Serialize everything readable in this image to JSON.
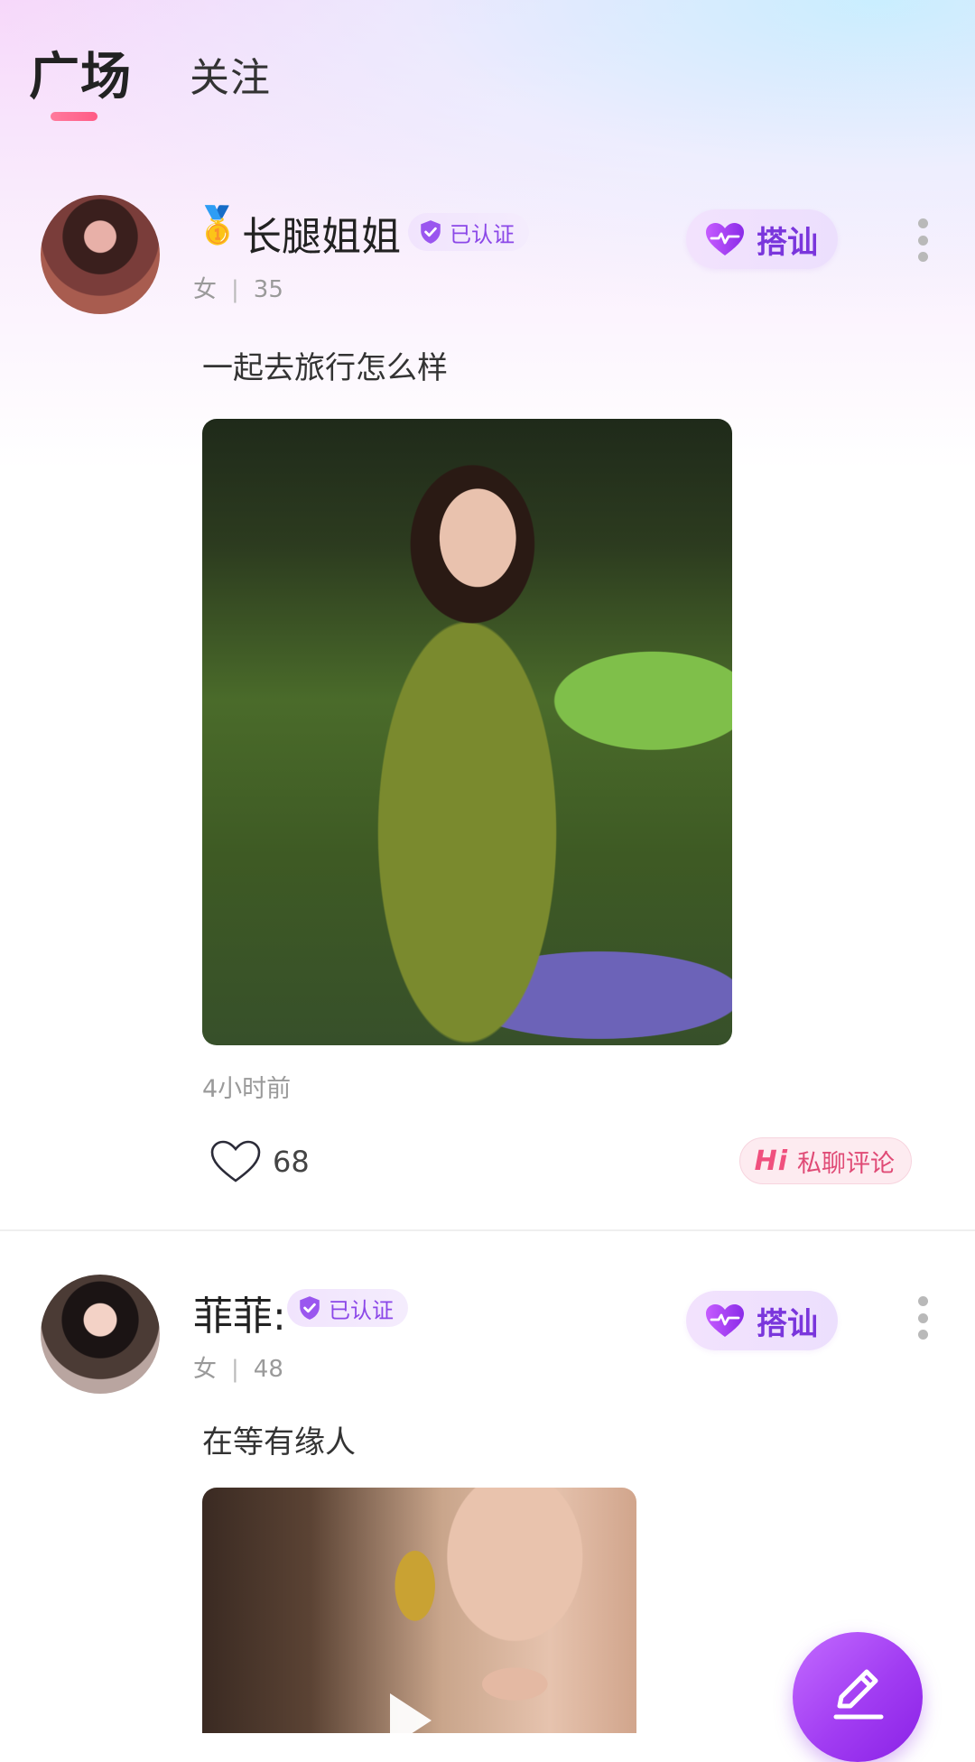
{
  "tabs": [
    {
      "label": "广场"
    },
    {
      "label": "关注"
    }
  ],
  "posts": [
    {
      "medal": "🥇",
      "name": "长腿姐姐",
      "verified": "已认证",
      "gender": "女",
      "age": "35",
      "greet": "搭讪",
      "text": "一起去旅行怎么样",
      "time": "4小时前",
      "likes": "68",
      "private_hi": "Hi",
      "private_label": "私聊评论"
    },
    {
      "name": "菲菲:",
      "verified": "已认证",
      "gender": "女",
      "age": "48",
      "greet": "搭讪",
      "text": "在等有缘人"
    }
  ],
  "colors": {
    "accent_purple": "#8b47e8",
    "tab_indicator": "#ff6a90",
    "hi_pink": "#e04b76"
  }
}
